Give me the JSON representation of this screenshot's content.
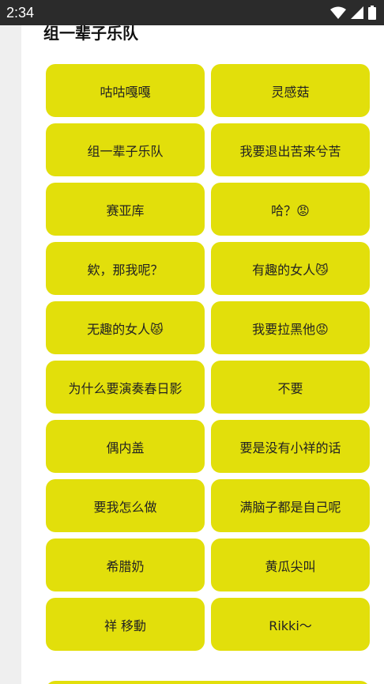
{
  "status_bar": {
    "time": "2:34",
    "icons": [
      "wifi-icon",
      "signal-icon",
      "battery-icon"
    ]
  },
  "section": {
    "title": "组一辈子乐队"
  },
  "tiles": [
    "咕咕嘎嘎",
    "灵感菇",
    "组一辈子乐队",
    "我要退出苦来兮苦",
    "赛亚库",
    "哈？😡",
    "欸，那我呢？",
    "有趣的女人😼",
    "无趣的女人😾",
    "我要拉黑他😡",
    "为什么要演奏春日影",
    "不要",
    "偶内盖",
    "要是没有小祥的话",
    "要我怎么做",
    "满脑子都是自己呢",
    "希腊奶",
    "黄瓜尖叫",
    "祥 移動",
    "Rikki〜"
  ],
  "colors": {
    "tile": "#e2df0b",
    "status_bar": "#2b2b2b",
    "rail": "#efefef"
  }
}
